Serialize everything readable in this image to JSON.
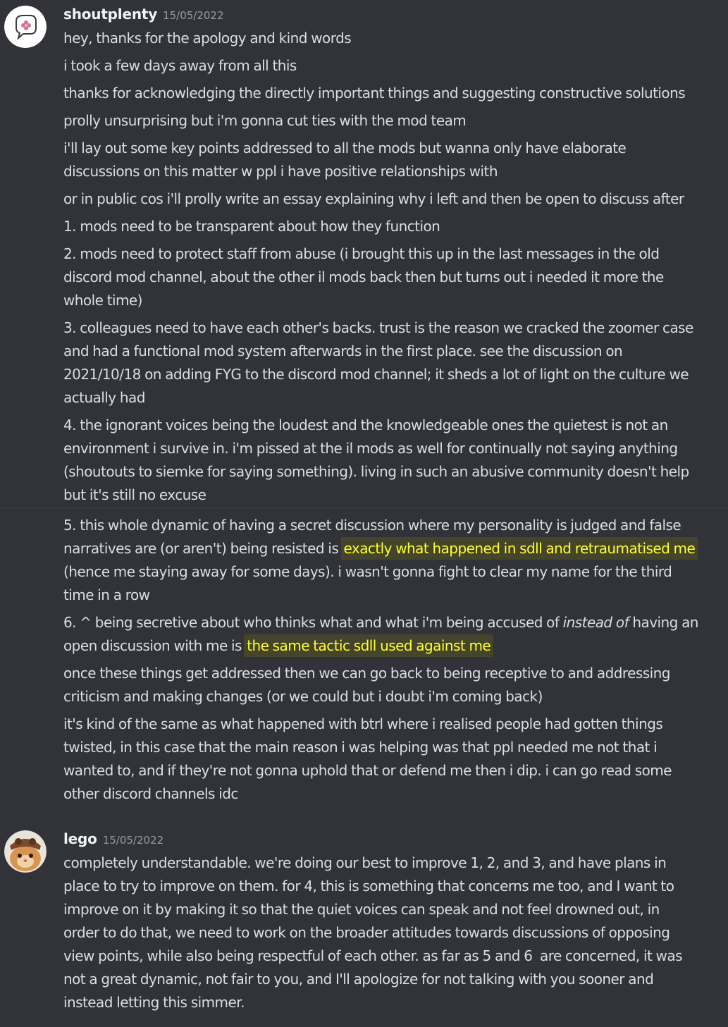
{
  "messages": [
    {
      "author": "shoutplenty",
      "timestamp": "15/05/2022",
      "avatar_icon": "flower-speech-bubble-avatar",
      "lines": [
        "hey, thanks for the apology and kind words",
        "i took a few days away from all this",
        "thanks for acknowledging the directly important things and suggesting constructive solutions",
        "prolly unsurprising but i'm gonna cut ties with the mod team",
        "i'll lay out some key points addressed to all the mods but wanna only have elaborate",
        "discussions on this matter w ppl i have positive relationships with",
        "or in public cos i'll prolly write an essay explaining why i left and then be open to discuss after",
        "1. mods need to be transparent about how they function",
        "2. mods need to protect staff from abuse (i brought this up in the last messages in the old",
        "discord mod channel, about the other il mods back then but turns out i needed it more the",
        "whole time)",
        "3. colleagues need to have each other's backs. trust is the reason we cracked the zoomer case",
        "and had a functional mod system afterwards in the first place. see the discussion on",
        "2021/10/18 on adding FYG to the discord mod channel; it sheds a lot of light on the culture we",
        "actually had",
        "4. the ignorant voices being the loudest and the knowledgeable ones the quietest is not an",
        "environment i survive in. i'm pissed at the il mods as well for continually not saying anything",
        "(shoutouts to siemke for saying something). living in such an abusive community doesn't help",
        "but it's still no excuse"
      ],
      "continued": {
        "p5_line1": "5. this whole dynamic of having a secret discussion where my personality is judged and false",
        "p5_line2_plain": "narratives are (or aren't) being resisted is ",
        "p5_line2_highlight": "exactly what happened in sdll and retraumatised me",
        "p5_line3": "(hence me staying away for some days). i wasn't gonna fight to clear my name for the third",
        "p5_line4": "time in a row",
        "p6_line1_a": "6. ^ being secretive about who thinks what and what i'm being accused of ",
        "p6_line1_em": "instead of",
        "p6_line1_b": " having an",
        "p6_line2_plain": "open discussion with me is ",
        "p6_line2_highlight": "the same tactic sdll used against me",
        "l1": "once these things get addressed then we can go back to being receptive to and addressing",
        "l2": "criticism and making changes (or we could but i doubt i'm coming back)",
        "l3": "it's kind of the same as what happened with btrl where i realised people had gotten things",
        "l4": "twisted, in this case that the main reason i was helping was that ppl needed me not that i",
        "l5": "wanted to, and if they're not gonna uphold that or defend me then i dip. i can go read some",
        "l6": "other discord channels idc"
      }
    },
    {
      "author": "lego",
      "timestamp": "15/05/2022",
      "avatar_icon": "cat-with-hat-avatar",
      "lines": [
        "completely understandable. we're doing our best to improve 1, 2, and 3, and have plans in",
        "place to try to improve on them. for 4, this is something that concerns me too, and I want to",
        "improve on it by making it so that the quiet voices can speak and not feel drowned out, in",
        "order to do that, we need to work on the broader attitudes towards discussions of opposing",
        "view points, while also being respectful of each other. as far as 5 and 6  are concerned, it was",
        "not a great dynamic, not fair to you, and I'll apologize for not talking with you sooner and",
        "instead letting this simmer."
      ]
    }
  ],
  "colors": {
    "background": "#313338",
    "text": "#dbdee1",
    "username": "#f2f3f5",
    "timestamp": "#949ba4",
    "highlight_bg": "#45452c",
    "highlight_text": "#ffff2e"
  }
}
